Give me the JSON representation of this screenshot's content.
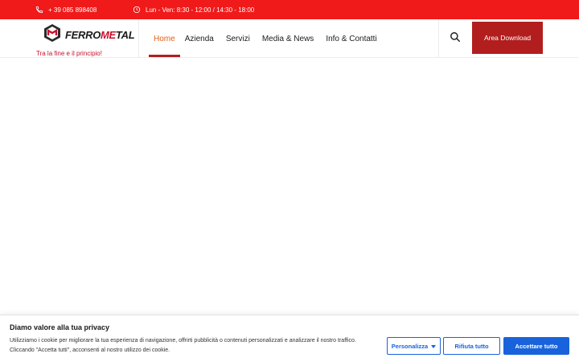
{
  "topbar": {
    "phone": "+ 39 085 898408",
    "hours": "Lun - Ven: 8:30 - 12:00 / 14:30 - 18:00",
    "phone_icon": "phone-icon",
    "clock_icon": "clock-icon"
  },
  "header": {
    "logo_text_a": "FERRO",
    "logo_text_b": "ME",
    "logo_text_c": "T",
    "logo_text_d": "AL",
    "tagline": "Tra la fine e il principio!",
    "nav": [
      "Home",
      "Azienda",
      "Servizi",
      "Media & News",
      "Info & Contatti"
    ],
    "search_icon": "search-icon",
    "download_label": "Area Download"
  },
  "cookie": {
    "title": "Diamo valore alla tua privacy",
    "text": "Utilizziamo i cookie per migliorare la tua esperienza di navigazione, offrirti pubblicità o contenuti personalizzati e analizzare il nostro traffico. Cliccando \"Accetta tutti\", acconsenti al nostro utilizzo dei cookie.",
    "customize": "Personalizza",
    "reject": "Rifiuta tutto",
    "accept": "Accettare tutto"
  },
  "colors": {
    "topbar": "#f01a1a",
    "brand_red": "#b21e1e",
    "nav_active": "#e0601a",
    "cookie_blue": "#1863dc"
  }
}
